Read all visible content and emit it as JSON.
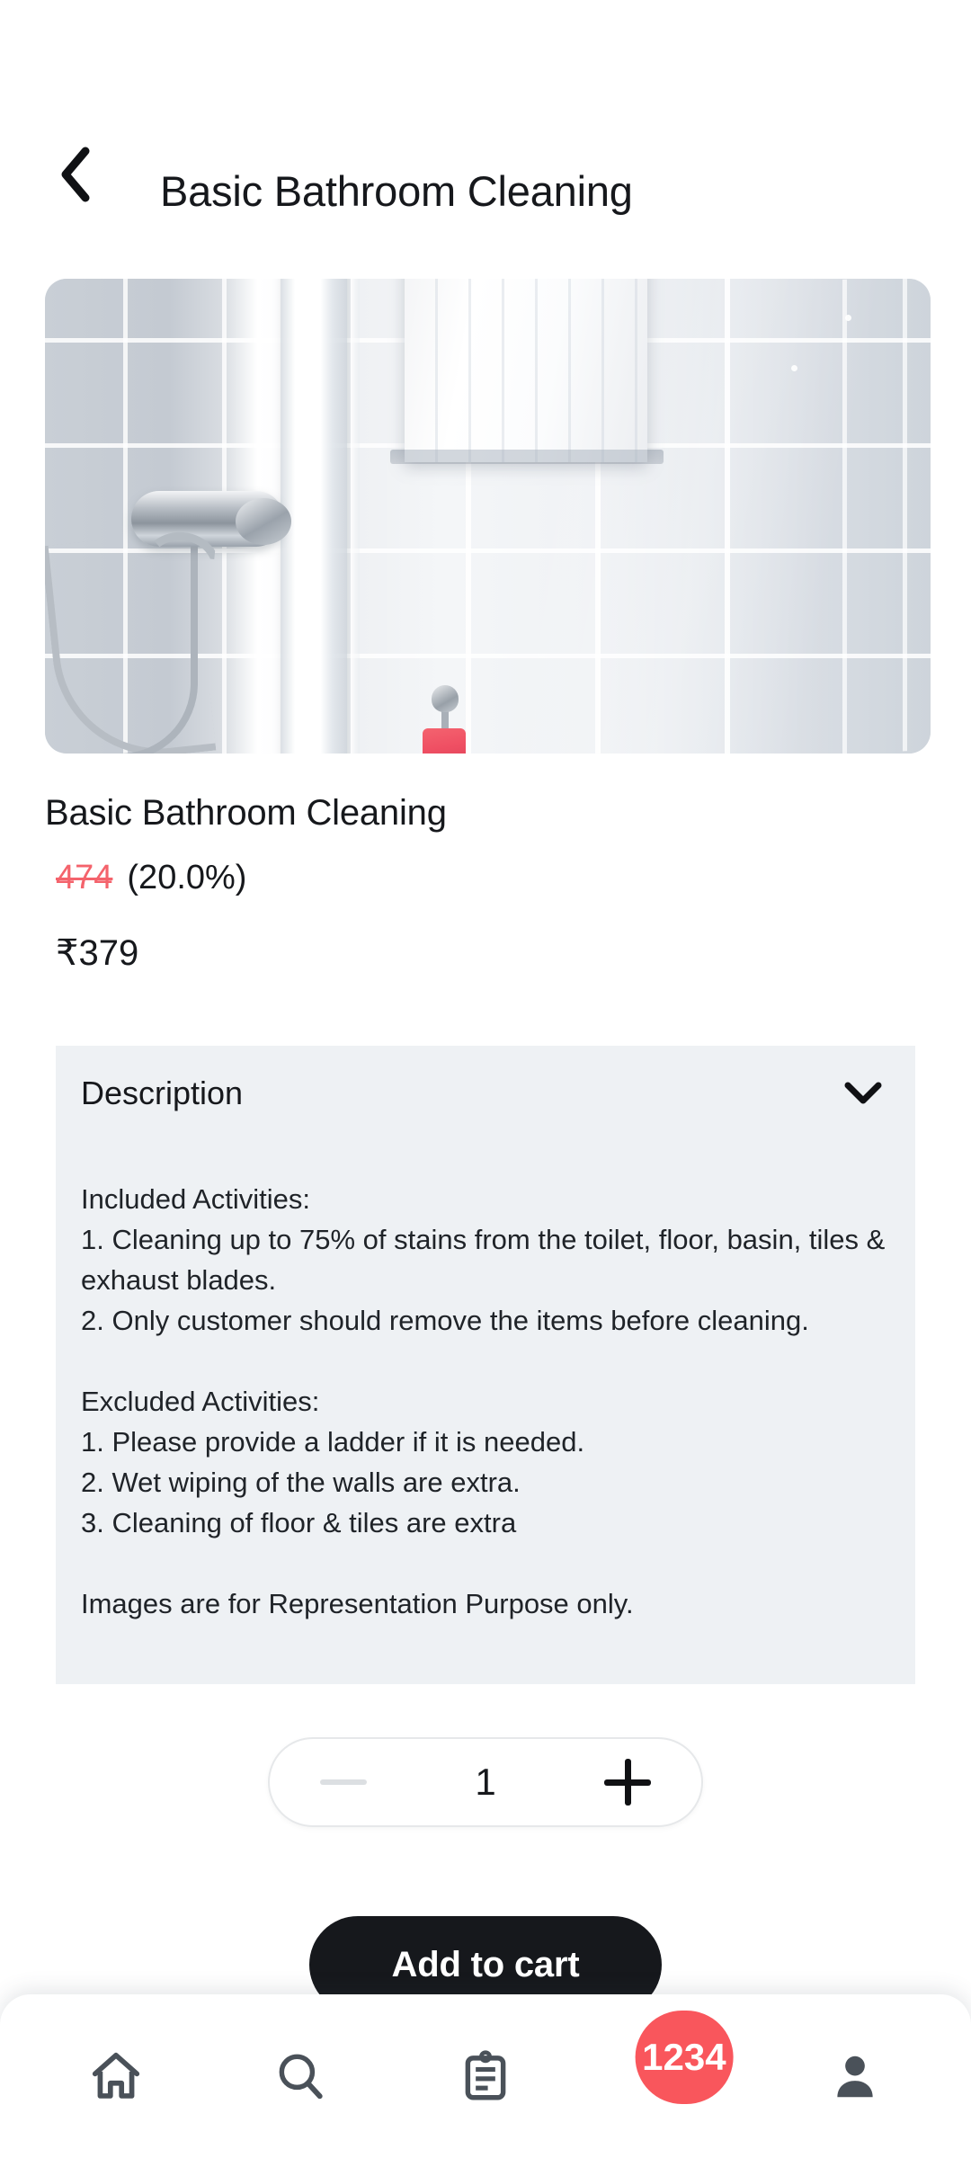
{
  "header": {
    "back_icon": "chevron-left-icon",
    "title": "Basic Bathroom Cleaning"
  },
  "hero": {
    "alt": "bathroom-shower-tiles-photo"
  },
  "product": {
    "name": "Basic Bathroom Cleaning",
    "original_price": "474",
    "discount": "(20.0%)",
    "final_price": "₹379"
  },
  "description": {
    "title": "Description",
    "chevron_icon": "chevron-down-icon",
    "body": "Included Activities:\n1. Cleaning up to 75% of stains from the toilet, floor, basin, tiles & exhaust blades.\n2. Only customer should remove the items before cleaning.\n\nExcluded Activities:\n1. Please provide a ladder if it is needed.\n2. Wet wiping of the walls are extra.\n3. Cleaning of floor & tiles are extra\n\nImages are for Representation Purpose only."
  },
  "stepper": {
    "minus_label": "minus-icon",
    "quantity": "1",
    "plus_label": "plus-icon"
  },
  "cart": {
    "add_label": "Add to cart"
  },
  "bottom_nav": {
    "items": [
      {
        "name": "home",
        "icon": "home-icon"
      },
      {
        "name": "search",
        "icon": "search-icon"
      },
      {
        "name": "orders",
        "icon": "clipboard-icon"
      },
      {
        "name": "cart",
        "icon": "shopping-cart-icon",
        "badge": "1234"
      },
      {
        "name": "profile",
        "icon": "person-icon"
      }
    ]
  },
  "colors": {
    "accent_red": "#f9565c",
    "strike_red": "#f4636c",
    "dark": "#16181c",
    "card_bg": "#eef1f4",
    "nav_icon": "#4a5159"
  }
}
